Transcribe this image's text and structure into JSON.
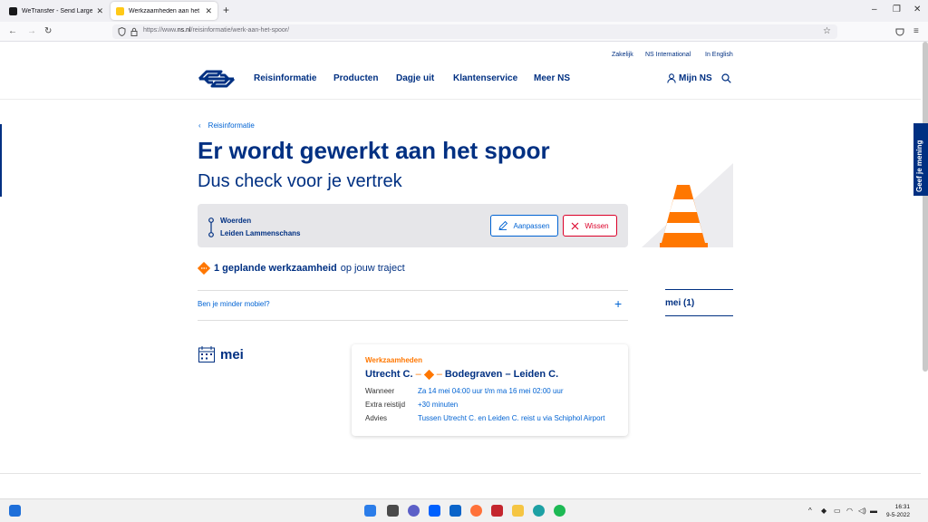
{
  "browser": {
    "tabs": [
      {
        "title": "WeTransfer - Send Large Files &",
        "active": false
      },
      {
        "title": "Werkzaamheden aan het spoor",
        "active": true
      }
    ],
    "url_prefix": "https://www.",
    "url_domain": "ns.nl",
    "url_path": "/reisinformatie/werk-aan-het-spoor/"
  },
  "header": {
    "top_links": [
      "Zakelijk",
      "NS International",
      "In English"
    ],
    "nav": [
      "Reisinformatie",
      "Producten",
      "Dagje uit",
      "Klantenservice",
      "Meer NS"
    ],
    "account": "Mijn NS"
  },
  "page": {
    "breadcrumb": "Reisinformatie",
    "title": "Er wordt gewerkt aan het spoor",
    "subtitle": "Dus check voor je vertrek",
    "route": {
      "from": "Woerden",
      "to": "Leiden Lammenschans"
    },
    "edit_label": "Aanpassen",
    "clear_label": "Wissen",
    "planned_bold": "1 geplande werkzaamheid",
    "planned_rest": "op jouw traject",
    "mobility_link": "Ben je minder mobiel?",
    "month": "mei",
    "side_month": "mei (1)",
    "feedback": "Geef je mening"
  },
  "card": {
    "kind": "Werkzaamheden",
    "from": "Utrecht C.",
    "to": "Bodegraven – Leiden C.",
    "rows": [
      {
        "label": "Wanneer",
        "value": "Za 14 mei 04:00 uur t/m ma 16 mei 02:00 uur"
      },
      {
        "label": "Extra reistijd",
        "value": "+30 minuten"
      },
      {
        "label": "Advies",
        "value": "Tussen Utrecht C. en Leiden C. reist u via Schiphol Airport"
      }
    ]
  },
  "taskbar": {
    "time": "16:31",
    "date": "9-5-2022"
  },
  "colors": {
    "ns_blue": "#003082",
    "link_blue": "#0063d3",
    "orange": "#ff7700",
    "red": "#db0029"
  }
}
